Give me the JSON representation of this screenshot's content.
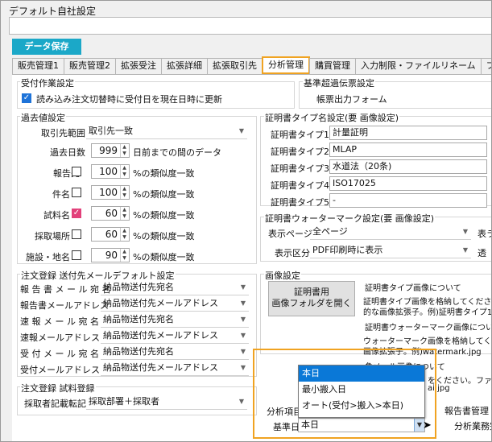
{
  "window": {
    "title": "デフォルト自社設定"
  },
  "toolbar": {
    "save_label": "データ保存"
  },
  "tabs": [
    {
      "label": "販売管理1"
    },
    {
      "label": "販売管理2"
    },
    {
      "label": "拡張受注"
    },
    {
      "label": "拡張詳細"
    },
    {
      "label": "拡張取引先"
    },
    {
      "label": "分析管理"
    },
    {
      "label": "購買管理"
    },
    {
      "label": "入力制限・ファイルリネーム"
    },
    {
      "label": "フォルダ設定"
    }
  ],
  "order_receipt": {
    "group_label": "受付作業設定",
    "checkbox_label": "読み込み注文切替時に受付日を現在日時に更新"
  },
  "standard_slip": {
    "group_label": "基準超過伝票設定",
    "form_label": "帳票出力フォーム"
  },
  "past_values": {
    "group_label": "過去値設定",
    "range_label": "取引先範囲",
    "range_value": "取引先一致",
    "days_label": "過去日数",
    "days_value": "999",
    "days_suffix": "日前までの間のデータ",
    "rows": [
      {
        "label": "報告先",
        "value": "100",
        "suffix": "%の類似度一致"
      },
      {
        "label": "件名",
        "value": "100",
        "suffix": "%の類似度一致"
      },
      {
        "label": "試料名",
        "value": "60",
        "suffix": "%の類似度一致"
      },
      {
        "label": "採取場所",
        "value": "60",
        "suffix": "%の類似度一致"
      },
      {
        "label": "施設・地名",
        "value": "90",
        "suffix": "%の類似度一致"
      }
    ]
  },
  "cert_types": {
    "group_label": "証明書タイプ名設定(要 画像設定)",
    "rows": [
      {
        "label": "証明書タイプ1",
        "value": "計量証明"
      },
      {
        "label": "証明書タイプ2",
        "value": "MLAP"
      },
      {
        "label": "証明書タイプ3",
        "value": "水道法（20条)"
      },
      {
        "label": "証明書タイプ4",
        "value": "ISO17025"
      },
      {
        "label": "証明書タイプ5",
        "value": "-"
      }
    ]
  },
  "watermark": {
    "group_label": "証明書ウォーターマーク設定(要 画像設定)",
    "page_label": "表示ページ",
    "page_value": "全ページ",
    "section_label": "表示区分",
    "section_value": "PDF印刷時に表示",
    "right_label_1": "表ラ",
    "right_label_2": "透"
  },
  "mail_defaults": {
    "group_label": "注文登録 送付先メールデフォルト設定",
    "rows": [
      {
        "label": "報 告 書 メ ー ル 宛 名",
        "value": "納品物送付先宛名"
      },
      {
        "label": "報告書メールアドレス",
        "value": "納品物送付先メールアドレス"
      },
      {
        "label": "速 報 メ ー ル 宛 名",
        "value": "納品物送付先宛名"
      },
      {
        "label": "速報メールアドレス",
        "value": "納品物送付先メールアドレス"
      },
      {
        "label": "受 付 メ ー ル 宛 名",
        "value": "納品物送付先宛名"
      },
      {
        "label": "受付メールアドレス",
        "value": "納品物送付先メールアドレス"
      }
    ]
  },
  "sample_reg": {
    "group_label": "注文登録 試料登録",
    "label": "採取者記載転記",
    "value": "採取部署＋採取者"
  },
  "image_settings": {
    "group_label": "画像設定",
    "open_folder_label": "証明書用\n画像フォルダを開く",
    "cert_image_header": "証明書タイプ画像について",
    "cert_image_text1": "証明書タイプ画像を格納してください。ファイ",
    "cert_image_text2": "的な画像拡張子。例)証明書タイプ1.p",
    "watermark_header": "証明書ウォーターマーク画像につい",
    "watermark_text1": "ウォーターマーク画像を格納してくださ",
    "watermark_text2": "画像拡張子。例)watermark.jpg",
    "stamp_header": "角メール画像について",
    "stamp_text1": "をください。ファイ",
    "stamp_text2": "ai.jpg"
  },
  "analysis": {
    "item_label": "分析項目",
    "base_date_label": "基準日",
    "base_date_value": "本日",
    "options": [
      "本日",
      "最小搬入日",
      "オート(受付>搬入>本日)"
    ]
  },
  "report_mgmt": {
    "label1": "報告書管理",
    "label2": "分析業務完"
  }
}
